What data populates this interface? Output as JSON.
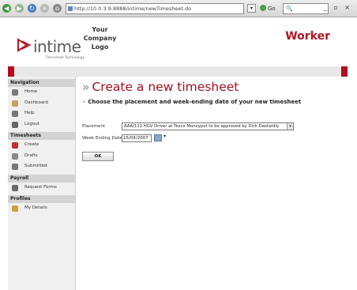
{
  "browser": {
    "url": "http://10.0.3.9:8888/intime/newTimesheet.do",
    "go_label": "Go",
    "search_placeholder": ""
  },
  "header": {
    "brand": "intime",
    "brand_tagline": "Timesheet Technology",
    "company_logo_line1": "Your",
    "company_logo_line2": "Company",
    "company_logo_line3": "Logo",
    "role": "Worker"
  },
  "sidebar": {
    "sections": [
      {
        "title": "Navigation",
        "items": [
          {
            "label": "Home",
            "icon": "home-icon",
            "color": "#7a7a7a"
          },
          {
            "label": "Dashboard",
            "icon": "dashboard-icon",
            "color": "#c8a060"
          },
          {
            "label": "Help",
            "icon": "help-icon",
            "color": "#777777"
          },
          {
            "label": "Logout",
            "icon": "logout-icon",
            "color": "#666666"
          }
        ]
      },
      {
        "title": "Timesheets",
        "items": [
          {
            "label": "Create",
            "icon": "create-icon",
            "color": "#c03030"
          },
          {
            "label": "Drafts",
            "icon": "drafts-icon",
            "color": "#8a8a8a"
          },
          {
            "label": "Submitted",
            "icon": "submitted-icon",
            "color": "#777777"
          }
        ]
      },
      {
        "title": "Payroll",
        "items": [
          {
            "label": "Request Forms",
            "icon": "pound-icon",
            "color": "#6a6a6a"
          }
        ]
      },
      {
        "title": "Profiles",
        "items": [
          {
            "label": "My Details",
            "icon": "details-icon",
            "color": "#d0a040"
          }
        ]
      }
    ]
  },
  "main": {
    "title": "Create a new timesheet",
    "subtitle": "Choose the placement and week-ending date of your new timesheet",
    "placement_label": "Placement",
    "placement_value": "AAA/111 HGV Driver at Tesco Moneypot to be approved by Dick Dastardly",
    "week_ending_label": "Week Ending Date",
    "week_ending_value": "15/04/2007",
    "ok_label": "OK"
  },
  "colors": {
    "accent": "#b01826",
    "redbar": "#b30d1e",
    "sidebar_bg": "#f0f0f0"
  }
}
